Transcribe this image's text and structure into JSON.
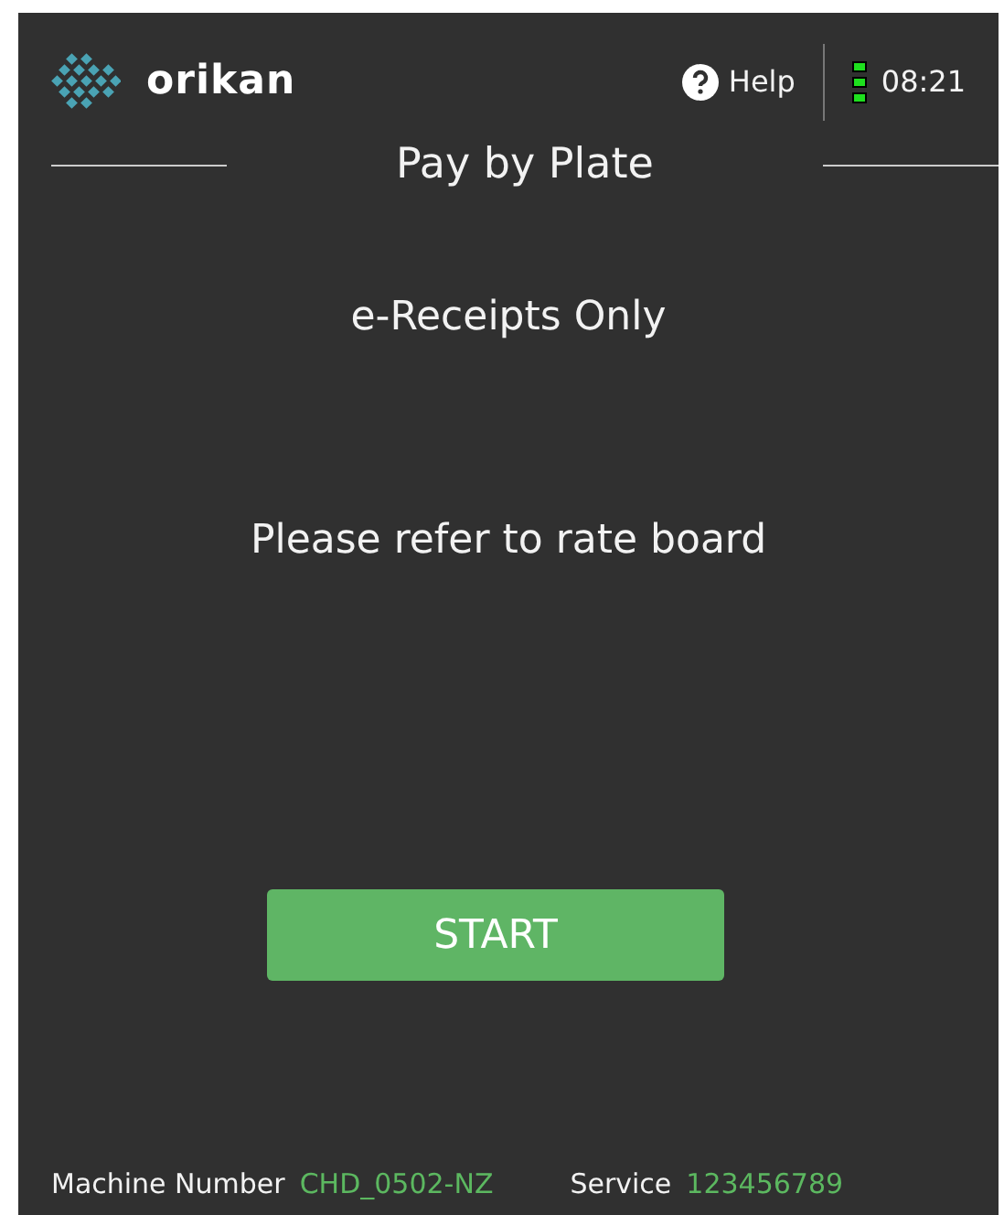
{
  "header": {
    "logo_text": "orikan",
    "help": "Help",
    "time": "08:21"
  },
  "title": "Pay by Plate",
  "messages": [
    "e-Receipts Only",
    "Please refer to rate board"
  ],
  "start_button": "START",
  "footer": {
    "machine_label": "Machine Number",
    "machine_value": "CHD_0502-NZ",
    "service_label": "Service",
    "service_value": "123456789"
  }
}
